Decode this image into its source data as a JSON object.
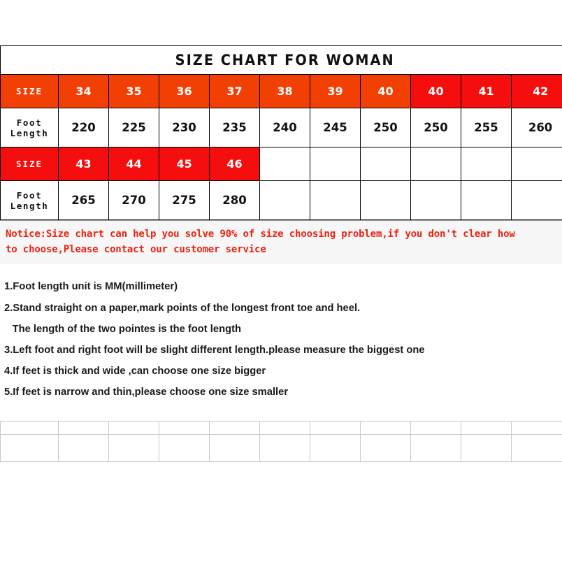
{
  "document": {
    "title": "SIZE CHART FOR WOMAN"
  },
  "table": {
    "row_label_size": "SIZE",
    "row_label_foot_length": "Foot Length",
    "colors": {
      "header_orange": "#f24005",
      "header_red": "#f50e0e",
      "notice_text": "#ee2211",
      "notice_background": "#f7f7f7",
      "border": "#000000",
      "grid_faint": "#c9c9c9"
    },
    "group1": {
      "sizes": [
        "34",
        "35",
        "36",
        "37",
        "38",
        "39",
        "40",
        "40",
        "41",
        "42"
      ],
      "size_cell_tones": [
        "orange",
        "orange",
        "orange",
        "orange",
        "orange",
        "orange",
        "orange",
        "red",
        "red",
        "red"
      ],
      "foot_lengths": [
        "220",
        "225",
        "230",
        "235",
        "240",
        "245",
        "250",
        "250",
        "255",
        "260"
      ]
    },
    "group2": {
      "sizes": [
        "43",
        "44",
        "45",
        "46",
        "",
        "",
        "",
        "",
        "",
        ""
      ],
      "size_cell_tones": [
        "red",
        "red",
        "red",
        "red",
        "blank",
        "blank",
        "blank",
        "blank",
        "blank",
        "blank"
      ],
      "foot_lengths": [
        "265",
        "270",
        "275",
        "280",
        "",
        "",
        "",
        "",
        "",
        ""
      ]
    }
  },
  "notice": {
    "line1": "Notice:Size chart can help you solve 90% of size choosing problem,if you don't clear how",
    "line2": "to choose,Please contact our customer service"
  },
  "instructions": {
    "item1": "1.Foot length unit is MM(millimeter)",
    "item2": "2.Stand straight on a paper,mark points of the longest front toe and heel.",
    "item2_cont": "The length of the two pointes is the foot length",
    "item3": "3.Left foot and right foot will be slight different length.please measure the biggest one",
    "item4": "4.If feet is thick and wide ,can choose one size bigger",
    "item5": "5.If feet is narrow and thin,please choose one size smaller"
  }
}
